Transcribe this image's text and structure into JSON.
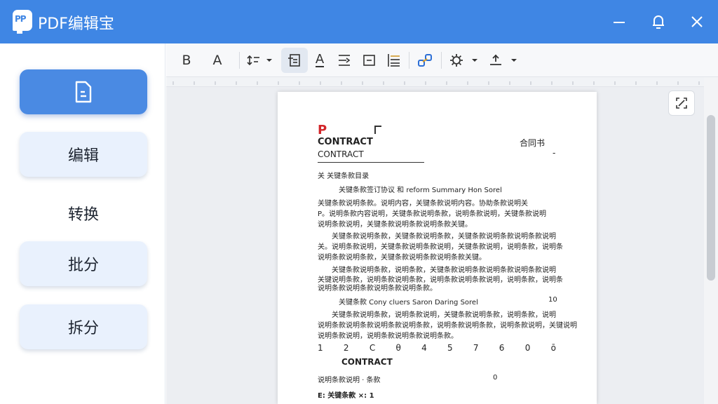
{
  "app": {
    "title": "PDF编辑宝",
    "logo_text": "PP",
    "accent": "#3f86e4"
  },
  "window_controls": {
    "minimize_icon": "minimize-icon",
    "bell_icon": "bell-icon",
    "close_icon": "close-icon"
  },
  "sidebar": {
    "items": [
      {
        "label": "",
        "icon": "document-icon",
        "active": true
      },
      {
        "label": "编辑"
      },
      {
        "label": "转换"
      },
      {
        "label": "批分"
      },
      {
        "label": "拆分"
      }
    ]
  },
  "toolbar": {
    "bold_label": "B",
    "text_label": "A",
    "font_color_label": "A"
  },
  "document": {
    "p_mark": "P",
    "heading": "CONTRACT",
    "subheading": "CONTRACT",
    "tag": "合同书",
    "dash": "-",
    "lines": [
      "关        关键条款目录",
      "关键条款签订协议 和 reform Summary Hon Sorel",
      "关键条款说明条款。说明内容，关键条款说明内容。协助条款说明关",
      "P。说明条款内容说明，关键条款说明条款，说明条款说明，关键条款说明",
      "说明条款说明，关键条款说明条款说明条款关键。",
      "关键条款说明条款，关键条款说明条款，关键条款说明条款说明条款说明",
      "关。说明条款说明，关键条款说明条款说明，关键条款说明，说明条款，说明条",
      "说明条款说明条款，关键条款说明条款说明条款关键。",
      "关键条款说明条款，说明条款，关键条款说明条款说明条款说明条款说明",
      "关键说明条款，说明条款说明条款，说明条款说明条款说明，说明条款，说明条",
      "说明条款说明条款说明条款说明条款。",
      "关键条款 Cony cluers Saron Daring Sorel",
      "关键条款说明条款，说明条款说明，关键条款说明条款，说明条款，说明",
      "说明条款说明条款说明条款说明条款，说明条款说明条款，说明条款说明，关键说明",
      "说明条款说明，说明条款说明条款说明条款。"
    ],
    "side_number": "10",
    "numbers": [
      "1",
      "2",
      "C",
      "θ",
      "4",
      "5",
      "7",
      "6",
      "0",
      "ō"
    ],
    "contract2": "CONTRACT",
    "footer1": "说明条款说明 · 条款",
    "footer1_value": "0",
    "footer2": "E:   关键条款 ×: 1"
  }
}
